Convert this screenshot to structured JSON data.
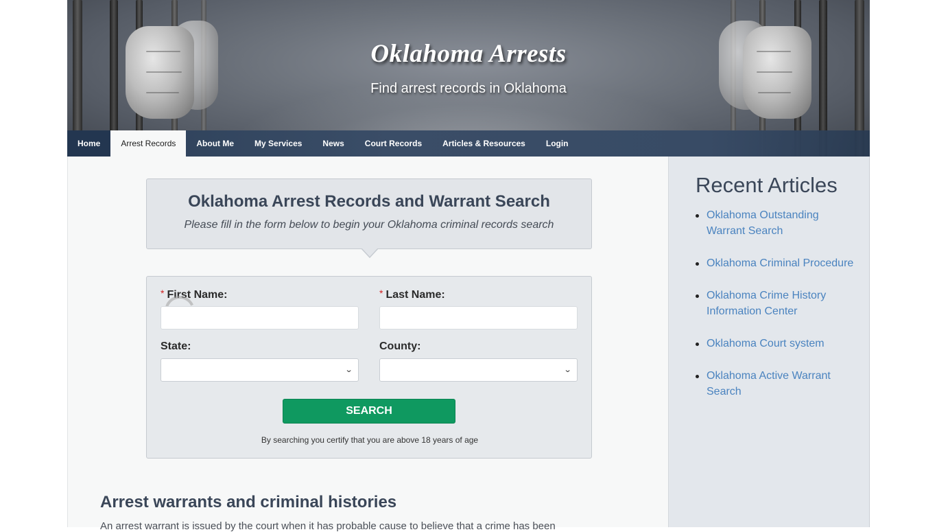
{
  "header": {
    "site_title": "Oklahoma Arrests",
    "tagline": "Find arrest records in Oklahoma"
  },
  "nav": {
    "items": [
      {
        "label": "Home"
      },
      {
        "label": "Arrest Records",
        "active": true
      },
      {
        "label": "About Me"
      },
      {
        "label": "My Services"
      },
      {
        "label": "News"
      },
      {
        "label": "Court Records"
      },
      {
        "label": "Articles & Resources"
      },
      {
        "label": "Login"
      }
    ]
  },
  "search_callout": {
    "title": "Oklahoma Arrest Records and Warrant Search",
    "subtitle": "Please fill in the form below to begin your Oklahoma criminal records search"
  },
  "search_form": {
    "required_marker": "*",
    "first_name_label": "First Name:",
    "first_name_value": "",
    "last_name_label": "Last Name:",
    "last_name_value": "",
    "state_label": "State:",
    "state_selected": "",
    "county_label": "County:",
    "county_selected": "",
    "submit_label": "SEARCH",
    "disclaimer": "By searching you certify that you are above 18 years of age",
    "accent_color": "#0f9960"
  },
  "article": {
    "heading": "Arrest warrants and criminal histories",
    "intro": "An arrest warrant is issued by the court when it has probable cause to believe that a crime has been"
  },
  "sidebar": {
    "title": "Recent Articles",
    "links": [
      {
        "label": "Oklahoma Outstanding Warrant Search"
      },
      {
        "label": "Oklahoma Criminal Procedure"
      },
      {
        "label": "Oklahoma Crime History Information Center"
      },
      {
        "label": "Oklahoma Court system"
      },
      {
        "label": "Oklahoma Active Warrant Search"
      }
    ],
    "link_color": "#4a83bf"
  }
}
